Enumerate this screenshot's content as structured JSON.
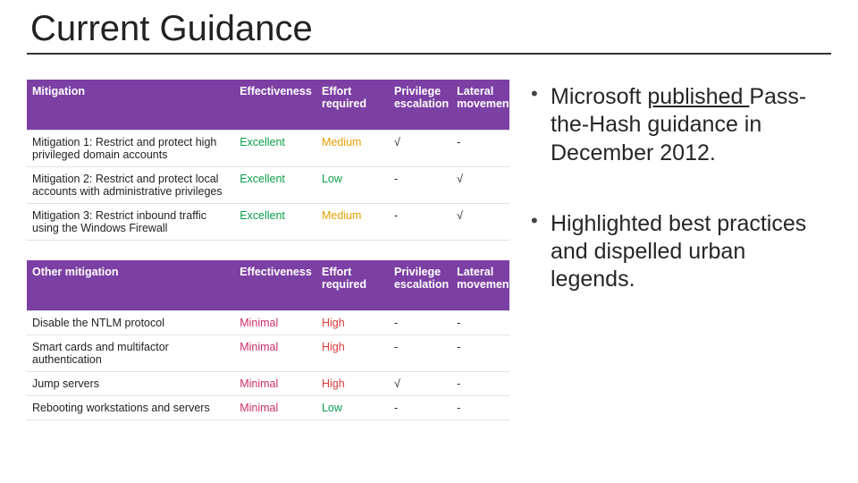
{
  "title": "Current Guidance",
  "colors": {
    "header_bg": "#7c3fa3",
    "excellent": "#0a9e4a",
    "minimal": "#cc2e6a",
    "medium": "#e6a000",
    "low": "#0a9e4a",
    "high": "#d93a3a"
  },
  "table_top": {
    "headers": {
      "mitigation": "Mitigation",
      "effectiveness": "Effectiveness",
      "effort": "Effort required",
      "priv": "Privilege escalation",
      "lateral": "Lateral movement"
    },
    "rows": [
      {
        "mitigation": "Mitigation 1: Restrict and protect high privileged domain accounts",
        "effectiveness": "Excellent",
        "effort": "Medium",
        "priv": "√",
        "lateral": "-"
      },
      {
        "mitigation": "Mitigation 2: Restrict and protect local accounts with administrative privileges",
        "effectiveness": "Excellent",
        "effort": "Low",
        "priv": "-",
        "lateral": "√"
      },
      {
        "mitigation": "Mitigation 3: Restrict inbound traffic using the Windows Firewall",
        "effectiveness": "Excellent",
        "effort": "Medium",
        "priv": "-",
        "lateral": "√"
      }
    ]
  },
  "table_bottom": {
    "headers": {
      "mitigation": "Other mitigation",
      "effectiveness": "Effectiveness",
      "effort": "Effort required",
      "priv": "Privilege escalation",
      "lateral": "Lateral movement"
    },
    "rows": [
      {
        "mitigation": "Disable the NTLM protocol",
        "effectiveness": "Minimal",
        "effort": "High",
        "priv": "-",
        "lateral": "-"
      },
      {
        "mitigation": "Smart cards and multifactor authentication",
        "effectiveness": "Minimal",
        "effort": "High",
        "priv": "-",
        "lateral": "-"
      },
      {
        "mitigation": "Jump servers",
        "effectiveness": "Minimal",
        "effort": "High",
        "priv": "√",
        "lateral": "-"
      },
      {
        "mitigation": "Rebooting workstations and servers",
        "effectiveness": "Minimal",
        "effort": "Low",
        "priv": "-",
        "lateral": "-"
      }
    ]
  },
  "bullets": {
    "b0_pre": "Microsoft ",
    "b0_link": "published ",
    "b0_post": "Pass-the-Hash guidance in December 2012.",
    "b1": "Highlighted best practices and dispelled urban legends."
  }
}
